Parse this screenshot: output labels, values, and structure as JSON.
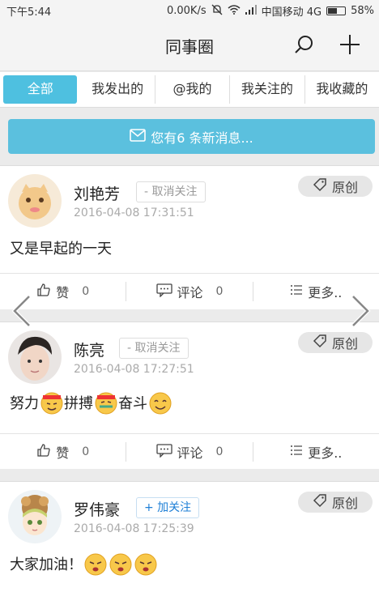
{
  "status": {
    "time": "下午5:44",
    "speed": "0.00K/s",
    "carrier": "中国移动 4G",
    "battery": "58%",
    "battery_level": 0.58
  },
  "nav": {
    "title": "同事圈",
    "search_icon": "search-icon",
    "add_icon": "plus-icon"
  },
  "tabs": [
    {
      "label": "全部",
      "active": true
    },
    {
      "label": "我发出的"
    },
    {
      "label": "@我的"
    },
    {
      "label": "我关注的"
    },
    {
      "label": "我收藏的"
    }
  ],
  "message_bar": {
    "text": "您有6 条新消息..."
  },
  "posts": [
    {
      "name": "刘艳芳",
      "follow": "- 取消关注",
      "time": "2016-04-08 17:31:51",
      "tag": "原创",
      "content": "又是早起的一天",
      "like_label": "赞",
      "like_count": "0",
      "comment_label": "评论",
      "comment_count": "0",
      "more_label": "更多.."
    },
    {
      "name": "陈亮",
      "follow": "- 取消关注",
      "time": "2016-04-08 17:27:51",
      "tag": "原创",
      "content": [
        "努力",
        "拼搏",
        "奋斗"
      ],
      "like_label": "赞",
      "like_count": "0",
      "comment_label": "评论",
      "comment_count": "0",
      "more_label": "更多.."
    },
    {
      "name": "罗伟豪",
      "follow": "+ 加关注",
      "time": "2016-04-08 17:25:39",
      "tag": "原创",
      "content": "大家加油！"
    }
  ],
  "colors": {
    "accent": "#4ec0e0",
    "message_bar": "#5bc0de",
    "follow_add": "#1e7fd6"
  }
}
